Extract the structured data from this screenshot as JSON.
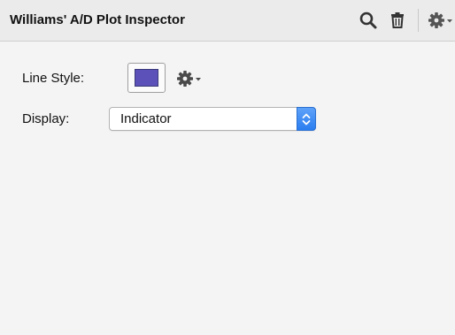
{
  "header": {
    "title": "Williams' A/D Plot Inspector",
    "icons": [
      "search-icon",
      "trash-icon",
      "gear-icon",
      "chevron-down-icon"
    ]
  },
  "fields": {
    "line_style_label": "Line Style:",
    "line_style_color": "#5b51b8",
    "display_label": "Display:",
    "display_value": "Indicator"
  },
  "colors": {
    "header_bg": "#ebebeb",
    "body_bg": "#f4f4f4",
    "select_accent": "#3b8cf5"
  }
}
